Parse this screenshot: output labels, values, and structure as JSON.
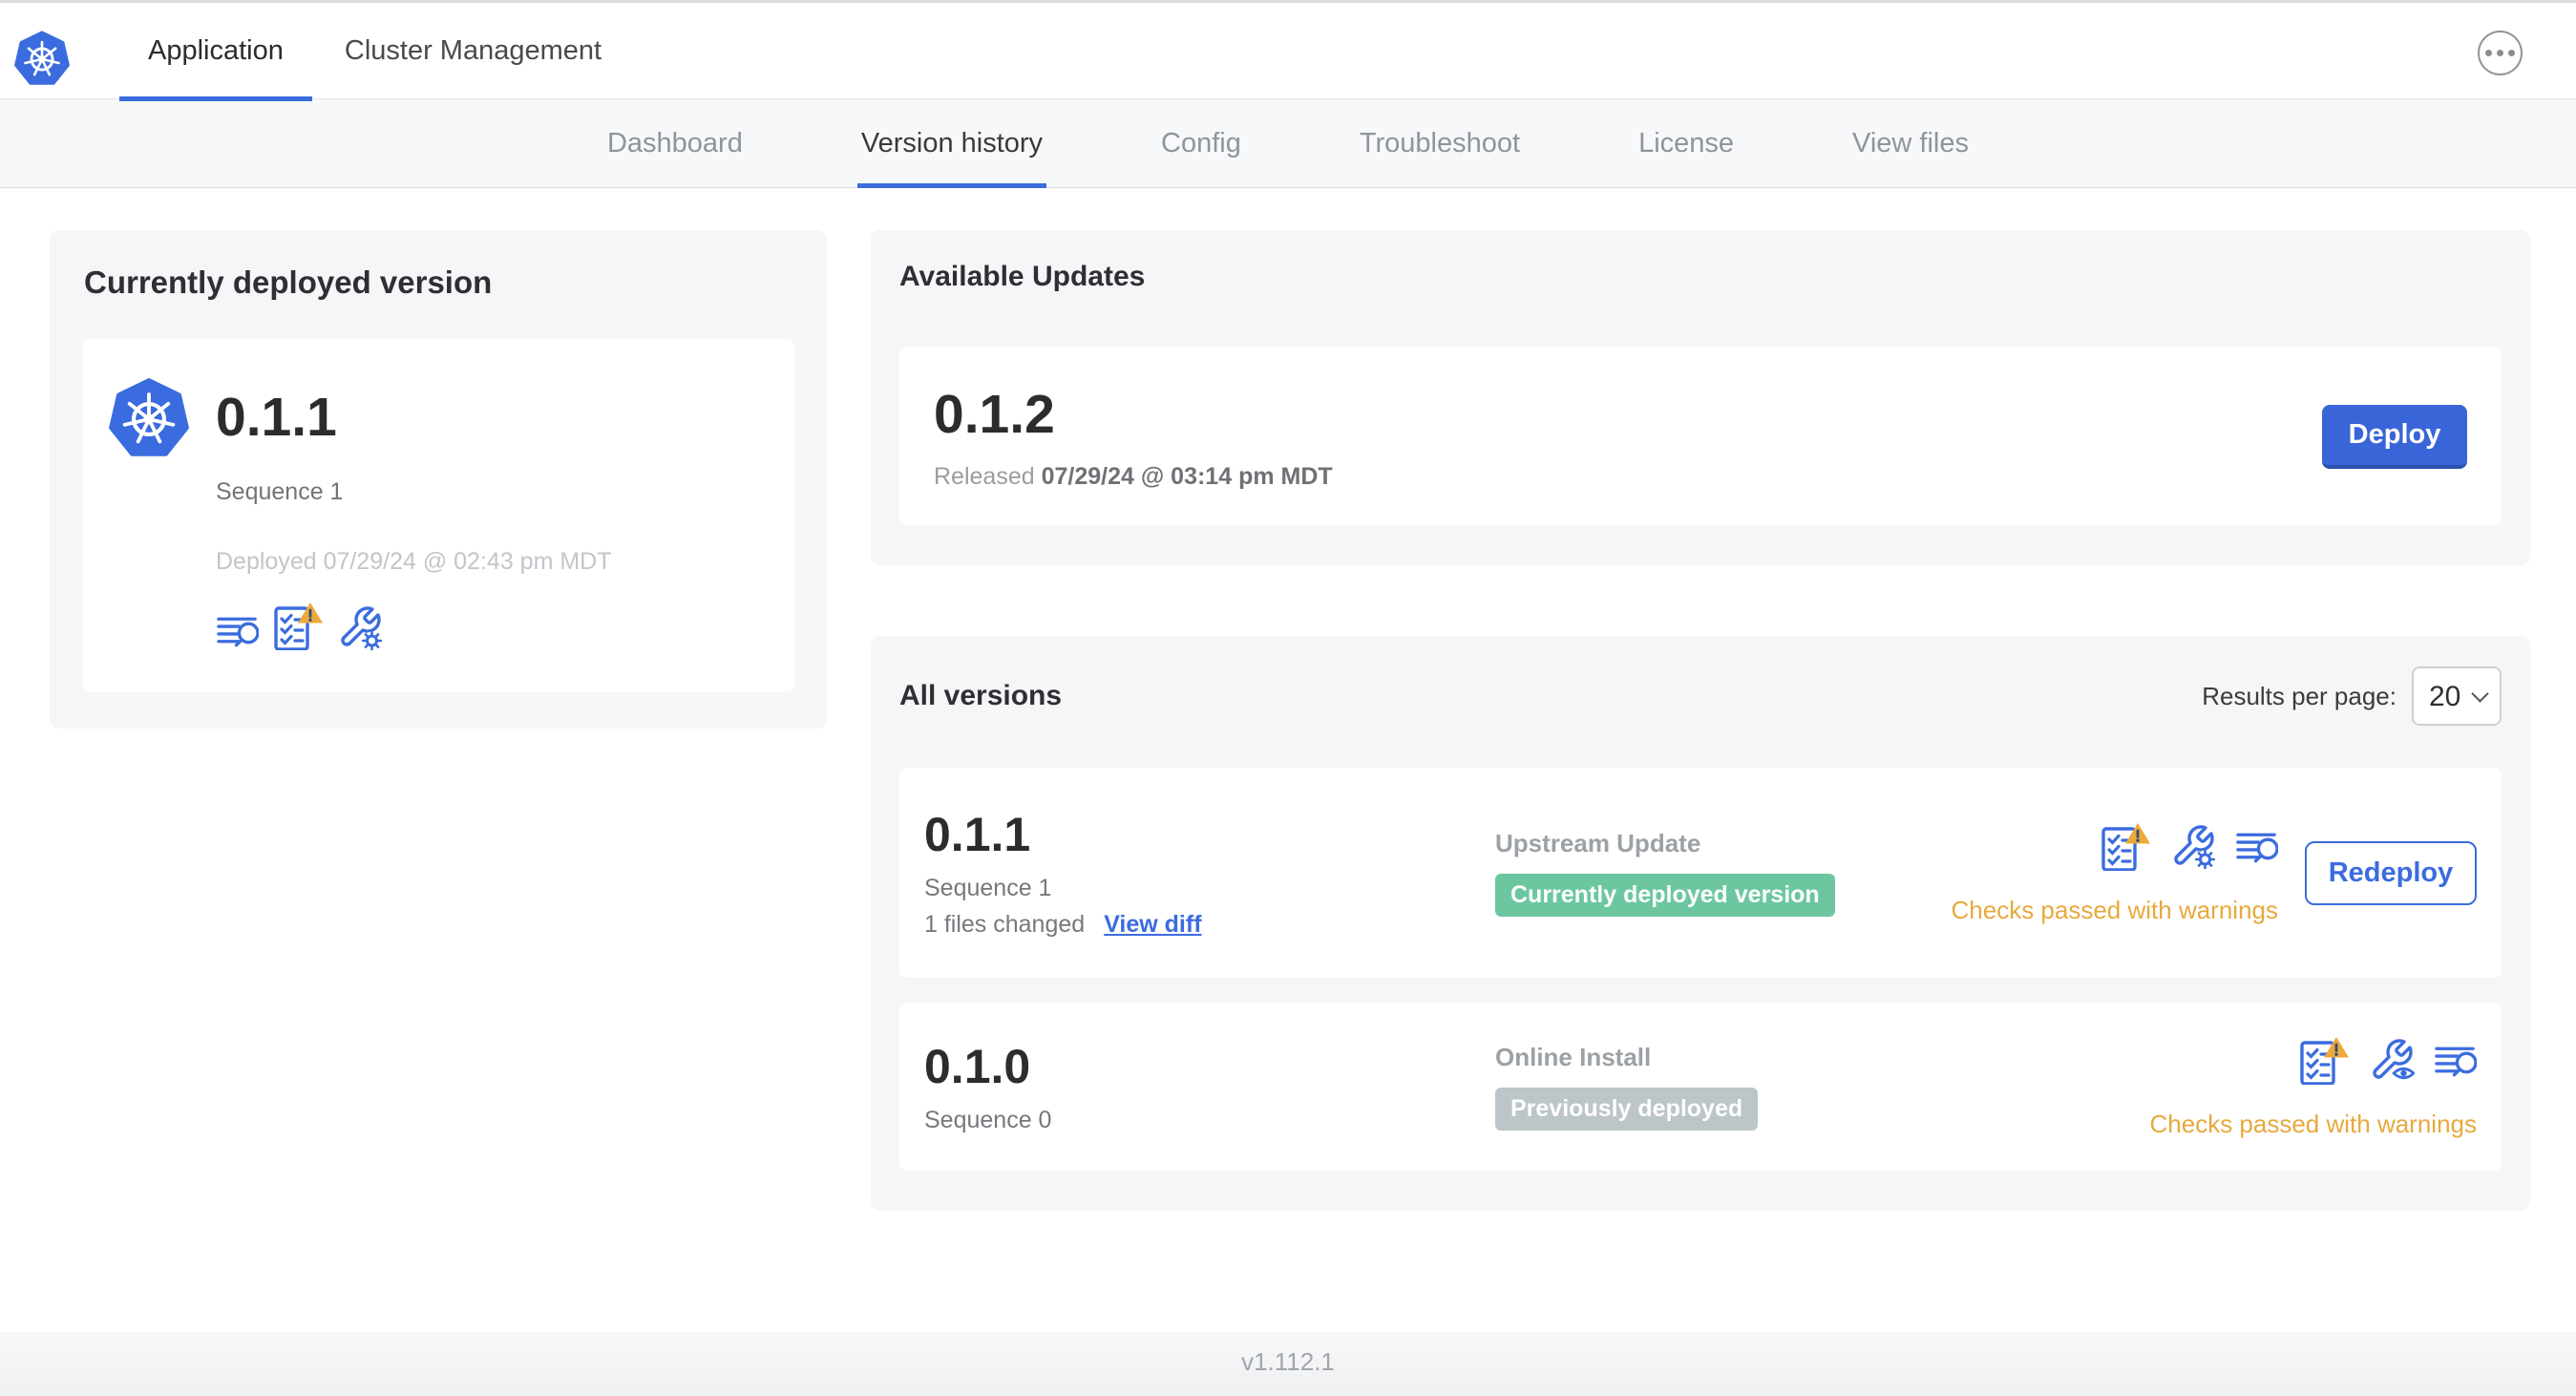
{
  "colors": {
    "accent_blue": "#3b6cde",
    "button_blue": "#3a65d8",
    "kubernetes_blue": "#3a6cdf",
    "warning_orange": "#e7a93d",
    "green_badge": "#6cc7a0",
    "gray_badge": "#bcc5c8"
  },
  "topbar": {
    "logo_icon": "kubernetes-logo-icon",
    "tabs": [
      {
        "label": "Application"
      },
      {
        "label": "Cluster Management"
      }
    ],
    "overflow_icon": "ellipsis-menu-icon"
  },
  "subnav": {
    "items": [
      {
        "label": "Dashboard"
      },
      {
        "label": "Version history"
      },
      {
        "label": "Config"
      },
      {
        "label": "Troubleshoot"
      },
      {
        "label": "License"
      },
      {
        "label": "View files"
      }
    ]
  },
  "current_version": {
    "title": "Currently deployed version",
    "version": "0.1.1",
    "sequence": "Sequence 1",
    "deployed": "Deployed 07/29/24 @ 02:43 pm MDT",
    "icons": [
      "release-notes-icon",
      "preflight-checks-warning-icon",
      "edit-config-icon"
    ]
  },
  "available_updates": {
    "title": "Available Updates",
    "version": "0.1.2",
    "released_label": "Released",
    "released_date": "07/29/24 @ 03:14 pm MDT",
    "deploy_label": "Deploy"
  },
  "all_versions": {
    "title": "All versions",
    "results_per_page_label": "Results per page:",
    "results_per_page_value": "20",
    "rows": [
      {
        "version": "0.1.1",
        "sequence": "Sequence 1",
        "files_changed": "1 files changed",
        "view_diff_label": "View diff",
        "source": "Upstream Update",
        "badge": "Currently deployed version",
        "badge_color": "#6cc7a0",
        "icons": [
          "preflight-checks-warning-icon",
          "edit-config-icon",
          "release-notes-icon"
        ],
        "action_label": "Redeploy",
        "status": "Checks passed with warnings",
        "status_color": "#e7a93d"
      },
      {
        "version": "0.1.0",
        "sequence": "Sequence 0",
        "source": "Online Install",
        "badge": "Previously deployed",
        "badge_color": "#bcc5c8",
        "icons": [
          "preflight-checks-warning-icon",
          "view-config-icon",
          "release-notes-icon"
        ],
        "status": "Checks passed with warnings",
        "status_color": "#e7a93d"
      }
    ]
  },
  "footer": {
    "app_version": "v1.112.1"
  }
}
